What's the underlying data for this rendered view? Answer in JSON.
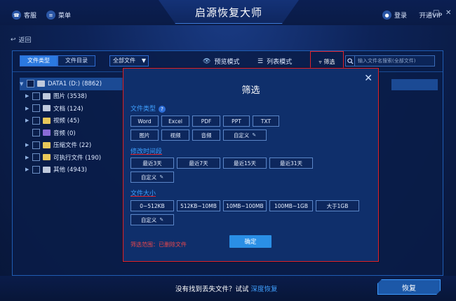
{
  "window": {
    "title": "启源恢复大师",
    "support_label": "客服",
    "menu_label": "菜单",
    "login_label": "登录",
    "vip_label": "开通VIP",
    "back_label": "返回"
  },
  "toolbar": {
    "tabs": [
      {
        "label": "文件类型",
        "active": true
      },
      {
        "label": "文件目录",
        "active": false
      }
    ],
    "filter_select_value": "全部文件",
    "preview_mode_label": "预览模式",
    "list_mode_label": "列表模式",
    "filter_label": "筛选",
    "search_placeholder": "输入文件名搜索(全部文件)"
  },
  "tree": {
    "root": {
      "label": "DATA1 (D:) (8862)"
    },
    "items": [
      {
        "label": "图片 (3538)",
        "expandable": true
      },
      {
        "label": "文档 (124)",
        "expandable": true
      },
      {
        "label": "视频 (45)",
        "expandable": true
      },
      {
        "label": "音频 (0)",
        "expandable": false
      },
      {
        "label": "压缩文件 (22)",
        "expandable": true
      },
      {
        "label": "可执行文件 (190)",
        "expandable": true
      },
      {
        "label": "其他 (4943)",
        "expandable": true
      }
    ]
  },
  "filter_dialog": {
    "title": "筛选",
    "file_type": {
      "title": "文件类型",
      "options_row1": [
        "Word",
        "Excel",
        "PDF",
        "PPT",
        "TXT"
      ],
      "options_row2": [
        "图片",
        "视频",
        "音频"
      ],
      "custom_label": "自定义"
    },
    "modified_time": {
      "title": "修改时间段",
      "options": [
        "最近3天",
        "最近7天",
        "最近15天",
        "最近31天"
      ],
      "custom_label": "自定义"
    },
    "file_size": {
      "title": "文件大小",
      "options": [
        "0~512KB",
        "512KB~10MB",
        "10MB~100MB",
        "100MB~1GB",
        "大于1GB"
      ],
      "custom_label": "自定义"
    },
    "scope_text": "筛选范围：已删除文件",
    "confirm_label": "确定"
  },
  "bottom": {
    "prompt_text": "没有找到丢失文件？试试",
    "deep_recover_label": "深度恢复",
    "recover_button_label": "恢复"
  },
  "colors": {
    "accent_blue": "#2b79e0",
    "highlight_red": "#e0222a",
    "section_title": "#3fa0ff"
  }
}
